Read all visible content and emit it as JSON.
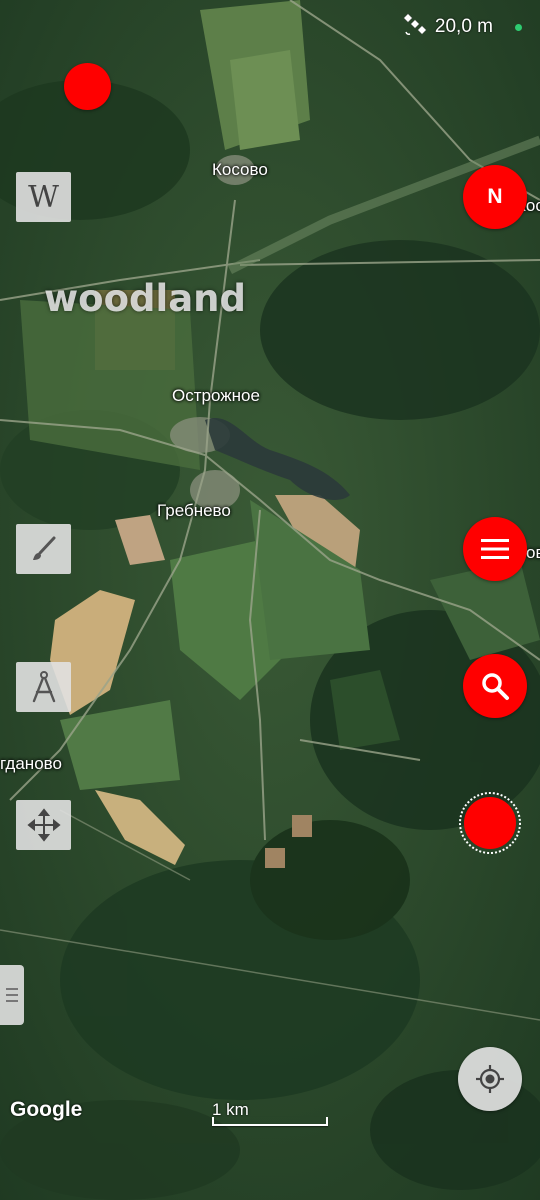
{
  "status": {
    "accuracy": "20,0 m",
    "gps_color": "#2ecc71"
  },
  "map": {
    "layer_label": "woodland",
    "places": [
      {
        "name": "Косово"
      },
      {
        "name": "Острожное"
      },
      {
        "name": "Гребнево"
      },
      {
        "name": "гданово"
      },
      {
        "name": "Кос"
      },
      {
        "name": "ов"
      }
    ],
    "scale_label": "1 km",
    "attribution": "Google"
  },
  "controls": {
    "compass_label": "N",
    "accent_color": "#ff0000",
    "icons": [
      "wikipedia-icon",
      "brush-icon",
      "compass-drawing-icon",
      "move-arrows-icon",
      "menu-icon",
      "search-icon",
      "record-icon",
      "locate-icon",
      "satellite-icon",
      "handle-icon"
    ]
  }
}
